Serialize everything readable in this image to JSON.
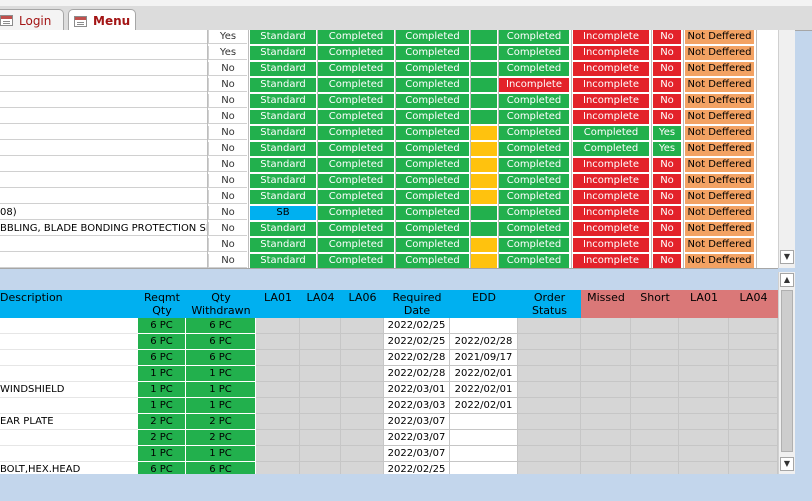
{
  "tabs": [
    {
      "label": "Login",
      "active": false
    },
    {
      "label": "Menu",
      "active": true
    }
  ],
  "upper_rows": [
    {
      "desc": "",
      "yn": "Yes",
      "c1": "Standard",
      "c2": "Completed",
      "c3": "Completed",
      "c4": "",
      "c5": "Completed",
      "c6": "Incomplete",
      "c7": "No",
      "c8": "Not Deffered"
    },
    {
      "desc": "",
      "yn": "Yes",
      "c1": "Standard",
      "c2": "Completed",
      "c3": "Completed",
      "c4": "",
      "c5": "Completed",
      "c6": "Incomplete",
      "c7": "No",
      "c8": "Not Deffered"
    },
    {
      "desc": "",
      "yn": "No",
      "c1": "Standard",
      "c2": "Completed",
      "c3": "Completed",
      "c4": "",
      "c5": "Completed",
      "c6": "Incomplete",
      "c7": "No",
      "c8": "Not Deffered"
    },
    {
      "desc": "",
      "yn": "No",
      "c1": "Standard",
      "c2": "Completed",
      "c3": "Completed",
      "c4": "",
      "c5": "Incomplete",
      "c6": "Incomplete",
      "c7": "No",
      "c8": "Not Deffered"
    },
    {
      "desc": "",
      "yn": "No",
      "c1": "Standard",
      "c2": "Completed",
      "c3": "Completed",
      "c4": "",
      "c5": "Completed",
      "c6": "Incomplete",
      "c7": "No",
      "c8": "Not Deffered"
    },
    {
      "desc": "",
      "yn": "No",
      "c1": "Standard",
      "c2": "Completed",
      "c3": "Completed",
      "c4": "",
      "c5": "Completed",
      "c6": "Incomplete",
      "c7": "No",
      "c8": "Not Deffered"
    },
    {
      "desc": "",
      "yn": "No",
      "c1": "Standard",
      "c2": "Completed",
      "c3": "Completed",
      "c4": "",
      "c5": "Completed",
      "c6": "Completed",
      "c7": "Yes",
      "c8": "Not Deffered"
    },
    {
      "desc": "",
      "yn": "No",
      "c1": "Standard",
      "c2": "Completed",
      "c3": "Completed",
      "c4": "",
      "c5": "Completed",
      "c6": "Completed",
      "c7": "Yes",
      "c8": "Not Deffered"
    },
    {
      "desc": "",
      "yn": "No",
      "c1": "Standard",
      "c2": "Completed",
      "c3": "Completed",
      "c4": "",
      "c5": "Completed",
      "c6": "Incomplete",
      "c7": "No",
      "c8": "Not Deffered"
    },
    {
      "desc": "",
      "yn": "No",
      "c1": "Standard",
      "c2": "Completed",
      "c3": "Completed",
      "c4": "",
      "c5": "Completed",
      "c6": "Incomplete",
      "c7": "No",
      "c8": "Not Deffered"
    },
    {
      "desc": "",
      "yn": "No",
      "c1": "Standard",
      "c2": "Completed",
      "c3": "Completed",
      "c4": "",
      "c5": "Completed",
      "c6": "Incomplete",
      "c7": "No",
      "c8": "Not Deffered"
    },
    {
      "desc": "08)",
      "yn": "No",
      "c1": "SB",
      "c2": "Completed",
      "c3": "Completed",
      "c4": "",
      "c5": "Completed",
      "c6": "Incomplete",
      "c7": "No",
      "c8": "Not Deffered"
    },
    {
      "desc": "BBLING, BLADE BONDING PROTECTION SLEEVE",
      "yn": "No",
      "c1": "Standard",
      "c2": "Completed",
      "c3": "Completed",
      "c4": "",
      "c5": "Completed",
      "c6": "Incomplete",
      "c7": "No",
      "c8": "Not Deffered"
    },
    {
      "desc": "",
      "yn": "No",
      "c1": "Standard",
      "c2": "Completed",
      "c3": "Completed",
      "c4": "",
      "c5": "Completed",
      "c6": "Incomplete",
      "c7": "No",
      "c8": "Not Deffered"
    },
    {
      "desc": "",
      "yn": "No",
      "c1": "Standard",
      "c2": "Completed",
      "c3": "Completed",
      "c4": "",
      "c5": "Completed",
      "c6": "Incomplete",
      "c7": "No",
      "c8": "Not Deffered"
    }
  ],
  "upper_colors": {
    "c1": [
      "g",
      "g",
      "g",
      "g",
      "g",
      "g",
      "g",
      "g",
      "g",
      "g",
      "g",
      "b",
      "g",
      "g",
      "g"
    ],
    "c4": [
      "g",
      "g",
      "g",
      "g",
      "g",
      "g",
      "y",
      "y",
      "y",
      "y",
      "y",
      "g",
      "g",
      "y",
      "y"
    ],
    "c5": [
      "g",
      "g",
      "g",
      "r",
      "g",
      "g",
      "g",
      "g",
      "g",
      "g",
      "g",
      "g",
      "g",
      "g",
      "g"
    ],
    "c6": [
      "r",
      "r",
      "r",
      "r",
      "r",
      "r",
      "g",
      "g",
      "r",
      "r",
      "r",
      "r",
      "r",
      "r",
      "r"
    ],
    "c7": [
      "r",
      "r",
      "r",
      "r",
      "r",
      "r",
      "g",
      "g",
      "r",
      "r",
      "r",
      "r",
      "r",
      "r",
      "r"
    ]
  },
  "lower_headers": {
    "description": "Description",
    "reqmt_qty": "Reqmt Qty",
    "qty_withdrawn": "Qty Withdrawn",
    "la01": "LA01",
    "la04": "LA04",
    "la06": "LA06",
    "required_date": "Required Date",
    "edd": "EDD",
    "order_status": "Order Status",
    "missed": "Missed",
    "short": "Short",
    "la01_b": "LA01",
    "la04_b": "LA04"
  },
  "lower_rows": [
    {
      "desc": "",
      "reqmt": "6 PC",
      "withdrawn": "6 PC",
      "required": "2022/02/25",
      "edd": ""
    },
    {
      "desc": "",
      "reqmt": "6 PC",
      "withdrawn": "6 PC",
      "required": "2022/02/25",
      "edd": "2022/02/28"
    },
    {
      "desc": "",
      "reqmt": "6 PC",
      "withdrawn": "6 PC",
      "required": "2022/02/28",
      "edd": "2021/09/17"
    },
    {
      "desc": "",
      "reqmt": "1 PC",
      "withdrawn": "1 PC",
      "required": "2022/02/28",
      "edd": "2022/02/01"
    },
    {
      "desc": "WINDSHIELD",
      "reqmt": "1 PC",
      "withdrawn": "1 PC",
      "required": "2022/03/01",
      "edd": "2022/02/01"
    },
    {
      "desc": "",
      "reqmt": "1 PC",
      "withdrawn": "1 PC",
      "required": "2022/03/03",
      "edd": "2022/02/01"
    },
    {
      "desc": "EAR PLATE",
      "reqmt": "2 PC",
      "withdrawn": "2 PC",
      "required": "2022/03/07",
      "edd": ""
    },
    {
      "desc": "",
      "reqmt": "2 PC",
      "withdrawn": "2 PC",
      "required": "2022/03/07",
      "edd": ""
    },
    {
      "desc": "",
      "reqmt": "1 PC",
      "withdrawn": "1 PC",
      "required": "2022/03/07",
      "edd": ""
    },
    {
      "desc": "BOLT,HEX.HEAD",
      "reqmt": "6 PC",
      "withdrawn": "6 PC",
      "required": "2022/02/25",
      "edd": ""
    }
  ],
  "scroll_icons": {
    "up": "▲",
    "down": "▼"
  }
}
